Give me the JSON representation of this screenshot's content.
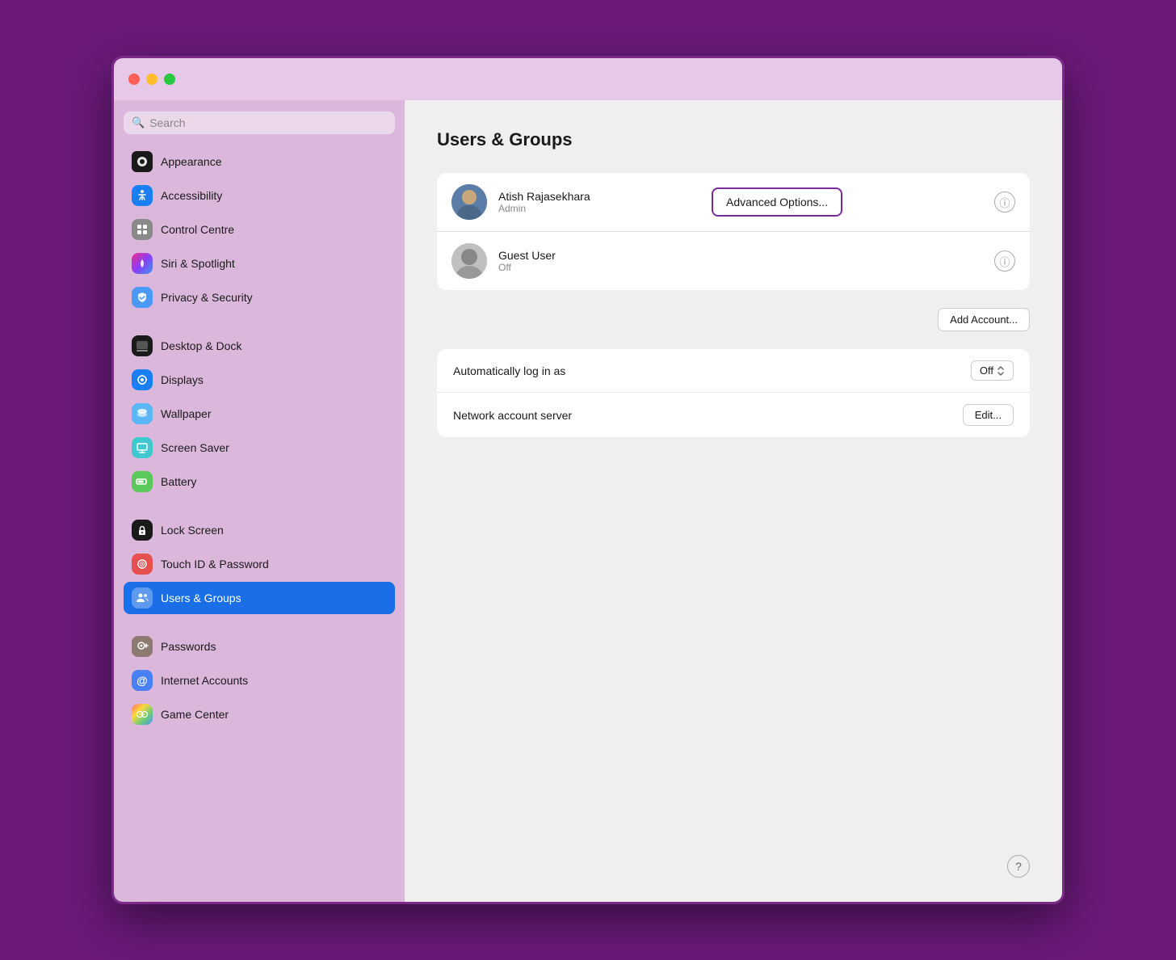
{
  "window": {
    "title": "Users & Groups"
  },
  "trafficLights": {
    "red": "close",
    "yellow": "minimize",
    "green": "maximize"
  },
  "sidebar": {
    "searchPlaceholder": "Search",
    "items": [
      {
        "id": "appearance",
        "label": "Appearance",
        "icon": "🖤",
        "iconBg": "#1a1a1a",
        "active": false
      },
      {
        "id": "accessibility",
        "label": "Accessibility",
        "icon": "♿",
        "iconBg": "#1a7ff5",
        "active": false
      },
      {
        "id": "control-centre",
        "label": "Control Centre",
        "icon": "⊞",
        "iconBg": "#8a8a8a",
        "active": false
      },
      {
        "id": "siri-spotlight",
        "label": "Siri & Spotlight",
        "icon": "✨",
        "iconBg": "linear-gradient(135deg,#f0308c,#8b3cf7,#3b9af0)",
        "active": false
      },
      {
        "id": "privacy-security",
        "label": "Privacy & Security",
        "icon": "🤚",
        "iconBg": "#4a9af5",
        "active": false
      },
      {
        "id": "desktop-dock",
        "label": "Desktop & Dock",
        "icon": "🖥",
        "iconBg": "#1a1a1a",
        "active": false
      },
      {
        "id": "displays",
        "label": "Displays",
        "icon": "☀",
        "iconBg": "#1a7ff5",
        "active": false
      },
      {
        "id": "wallpaper",
        "label": "Wallpaper",
        "icon": "❋",
        "iconBg": "#5cb8f5",
        "active": false
      },
      {
        "id": "screen-saver",
        "label": "Screen Saver",
        "icon": "⬜",
        "iconBg": "#40c8d0",
        "active": false
      },
      {
        "id": "battery",
        "label": "Battery",
        "icon": "🔋",
        "iconBg": "#5ac85a",
        "active": false
      },
      {
        "id": "lock-screen",
        "label": "Lock Screen",
        "icon": "🔒",
        "iconBg": "#1a1a1a",
        "active": false
      },
      {
        "id": "touchid-password",
        "label": "Touch ID & Password",
        "icon": "👆",
        "iconBg": "#e85050",
        "active": false
      },
      {
        "id": "users-groups",
        "label": "Users & Groups",
        "icon": "👥",
        "iconBg": "#1a6fe8",
        "active": true
      },
      {
        "id": "passwords",
        "label": "Passwords",
        "icon": "🔑",
        "iconBg": "#8a7a70",
        "active": false
      },
      {
        "id": "internet-accounts",
        "label": "Internet Accounts",
        "icon": "@",
        "iconBg": "#4a80f5",
        "active": false
      },
      {
        "id": "game-center",
        "label": "Game Center",
        "icon": "🎮",
        "iconBg": "#ffffff",
        "active": false
      }
    ]
  },
  "main": {
    "title": "Users & Groups",
    "users": [
      {
        "id": "atish",
        "name": "Atish Rajasekhara",
        "role": "Admin",
        "hasAdvancedOptions": true
      },
      {
        "id": "guest",
        "name": "Guest User",
        "role": "Off",
        "hasAdvancedOptions": false
      }
    ],
    "advancedOptionsLabel": "Advanced Options...",
    "addAccountLabel": "Add Account...",
    "settings": [
      {
        "id": "auto-login",
        "label": "Automatically log in as",
        "valueText": "Off",
        "controlType": "stepper"
      },
      {
        "id": "network-server",
        "label": "Network account server",
        "valueText": "Edit...",
        "controlType": "edit"
      }
    ],
    "helpLabel": "?"
  }
}
